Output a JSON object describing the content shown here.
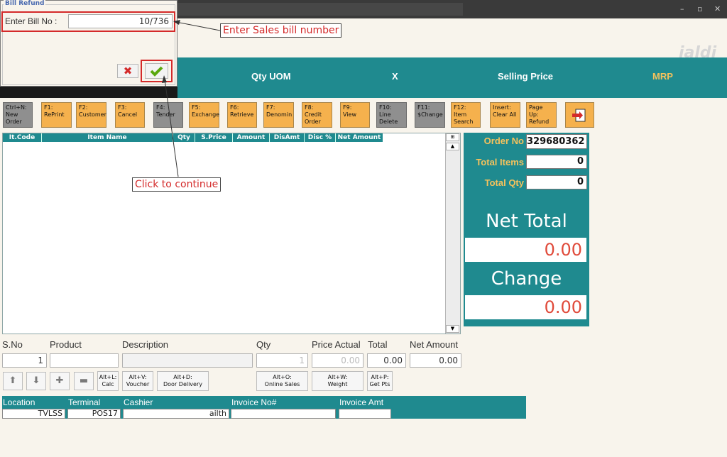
{
  "app": {
    "logo": "jaldi"
  },
  "dialog": {
    "title": "Bill Refund",
    "bill_label": "Enter Bill No :",
    "bill_value": "10/736",
    "cancel_icon": "close-icon",
    "ok_icon": "check-icon"
  },
  "banner": {
    "qty_uom": "Qty UOM",
    "x": "X",
    "selling_price": "Selling Price",
    "mrp": "MRP"
  },
  "fkeys": [
    {
      "l1": "Ctrl+N:",
      "l2": "New",
      "l3": "Order"
    },
    {
      "l1": "F1:",
      "l2": "RePrint",
      "l3": ""
    },
    {
      "l1": "F2:",
      "l2": "Customer",
      "l3": ""
    },
    {
      "l1": "F3:",
      "l2": "Cancel",
      "l3": ""
    },
    {
      "l1": "F4:",
      "l2": "Tender",
      "l3": ""
    },
    {
      "l1": "F5:",
      "l2": "Exchange",
      "l3": ""
    },
    {
      "l1": "F6:",
      "l2": "Retrieve",
      "l3": ""
    },
    {
      "l1": "F7:",
      "l2": "Denomin",
      "l3": ""
    },
    {
      "l1": "F8:",
      "l2": "Credit",
      "l3": "Order"
    },
    {
      "l1": "F9:",
      "l2": "View",
      "l3": ""
    },
    {
      "l1": "F10:",
      "l2": "Line",
      "l3": "Delete"
    },
    {
      "l1": "F11:",
      "l2": "$Change",
      "l3": ""
    },
    {
      "l1": "F12:",
      "l2": "Item",
      "l3": "Search"
    },
    {
      "l1": "Insert:",
      "l2": "Clear All",
      "l3": ""
    },
    {
      "l1": "Page Up:",
      "l2": "Refund",
      "l3": ""
    }
  ],
  "grid": {
    "columns": [
      "It.Code",
      "Item Name",
      "Qty",
      "S.Price",
      "Amount",
      "DisAmt",
      "Disc %",
      "Net Amount"
    ]
  },
  "summary": {
    "order_no_label": "Order No",
    "order_no": "329680362",
    "total_items_label": "Total Items",
    "total_items": "0",
    "total_qty_label": "Total Qty",
    "total_qty": "0",
    "net_total_label": "Net Total",
    "net_total": "0.00",
    "change_label": "Change",
    "change": "0.00"
  },
  "entry": {
    "sno_label": "S.No",
    "sno": "1",
    "product_label": "Product",
    "product": "",
    "description_label": "Description",
    "description": "",
    "qty_label": "Qty",
    "qty": "1",
    "price_label": "Price Actual",
    "price": "0.00",
    "total_label": "Total",
    "total": "0.00",
    "net_label": "Net Amount",
    "net": "0.00"
  },
  "small_buttons": {
    "calc": [
      "Alt+L:",
      "Calc"
    ],
    "voucher": [
      "Alt+V:",
      "Voucher"
    ],
    "door": [
      "Alt+D:",
      "Door Delivery"
    ],
    "online": [
      "Alt+O:",
      "Online Sales"
    ],
    "weight": [
      "Alt+W:",
      "Weight"
    ],
    "getpts": [
      "Alt+P:",
      "Get Pts"
    ]
  },
  "footer": {
    "location_label": "Location",
    "location": "TVLSS",
    "terminal_label": "Terminal",
    "terminal": "POS17",
    "cashier_label": "Cashier",
    "cashier": "ailth",
    "invoice_label": "Invoice No#",
    "invoice": "",
    "invoice_amt_label": "Invoice Amt",
    "invoice_amt": ""
  },
  "annotations": {
    "bill": "Enter Sales bill number",
    "click": "Click to continue"
  },
  "colors": {
    "teal": "#1f8a8f",
    "orange": "#f5b14d",
    "red": "#d42a2a"
  }
}
